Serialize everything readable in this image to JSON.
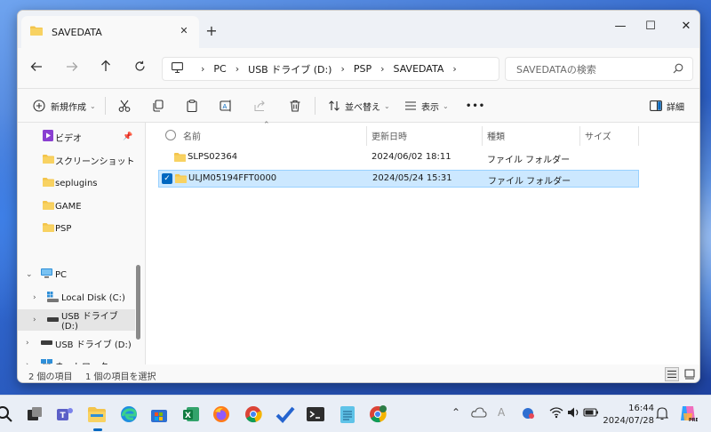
{
  "window": {
    "tab_title": "SAVEDATA",
    "new_tab_label": "+",
    "controls": {
      "minimize": "—",
      "maximize": "☐",
      "close": "✕"
    }
  },
  "addressbar": {
    "crumbs": [
      "PC",
      "USB ドライブ (D:)",
      "PSP",
      "SAVEDATA"
    ],
    "search_placeholder": "SAVEDATAの検索"
  },
  "toolbar": {
    "new_label": "新規作成",
    "sort_label": "並べ替え",
    "view_label": "表示",
    "more_label": "•••",
    "details_label": "詳細"
  },
  "navpane": {
    "items": [
      {
        "label": "ビデオ",
        "icon": "video-folder-icon"
      },
      {
        "label": "スクリーンショット",
        "icon": "folder-icon"
      },
      {
        "label": "seplugins",
        "icon": "folder-icon"
      },
      {
        "label": "GAME",
        "icon": "folder-icon"
      },
      {
        "label": "PSP",
        "icon": "folder-icon"
      },
      {
        "label": "PC",
        "icon": "pc-icon"
      },
      {
        "label": "Local Disk (C:)",
        "icon": "windows-drive-icon"
      },
      {
        "label": "USB ドライブ (D:)",
        "icon": "usb-drive-icon"
      },
      {
        "label": "USB ドライブ (D:)",
        "icon": "usb-drive-icon"
      },
      {
        "label": "ネットワーク",
        "icon": "network-icon"
      }
    ]
  },
  "filelist": {
    "columns": [
      "名前",
      "更新日時",
      "種類",
      "サイズ"
    ],
    "rows": [
      {
        "name": "SLPS02364",
        "modified": "2024/06/02 18:11",
        "type": "ファイル フォルダー",
        "size": "",
        "selected": false
      },
      {
        "name": "ULJM05194FFT0000",
        "modified": "2024/05/24 15:31",
        "type": "ファイル フォルダー",
        "size": "",
        "selected": true
      }
    ]
  },
  "statusbar": {
    "item_count": "2 個の項目",
    "selected_count": "1 個の項目を選択"
  },
  "taskbar": {
    "time": "16:44",
    "date": "2024/07/28",
    "ime_label": "A"
  },
  "colors": {
    "accent": "#0067c0",
    "selection_bg": "#cce8ff",
    "folder": "#f3c44b"
  }
}
